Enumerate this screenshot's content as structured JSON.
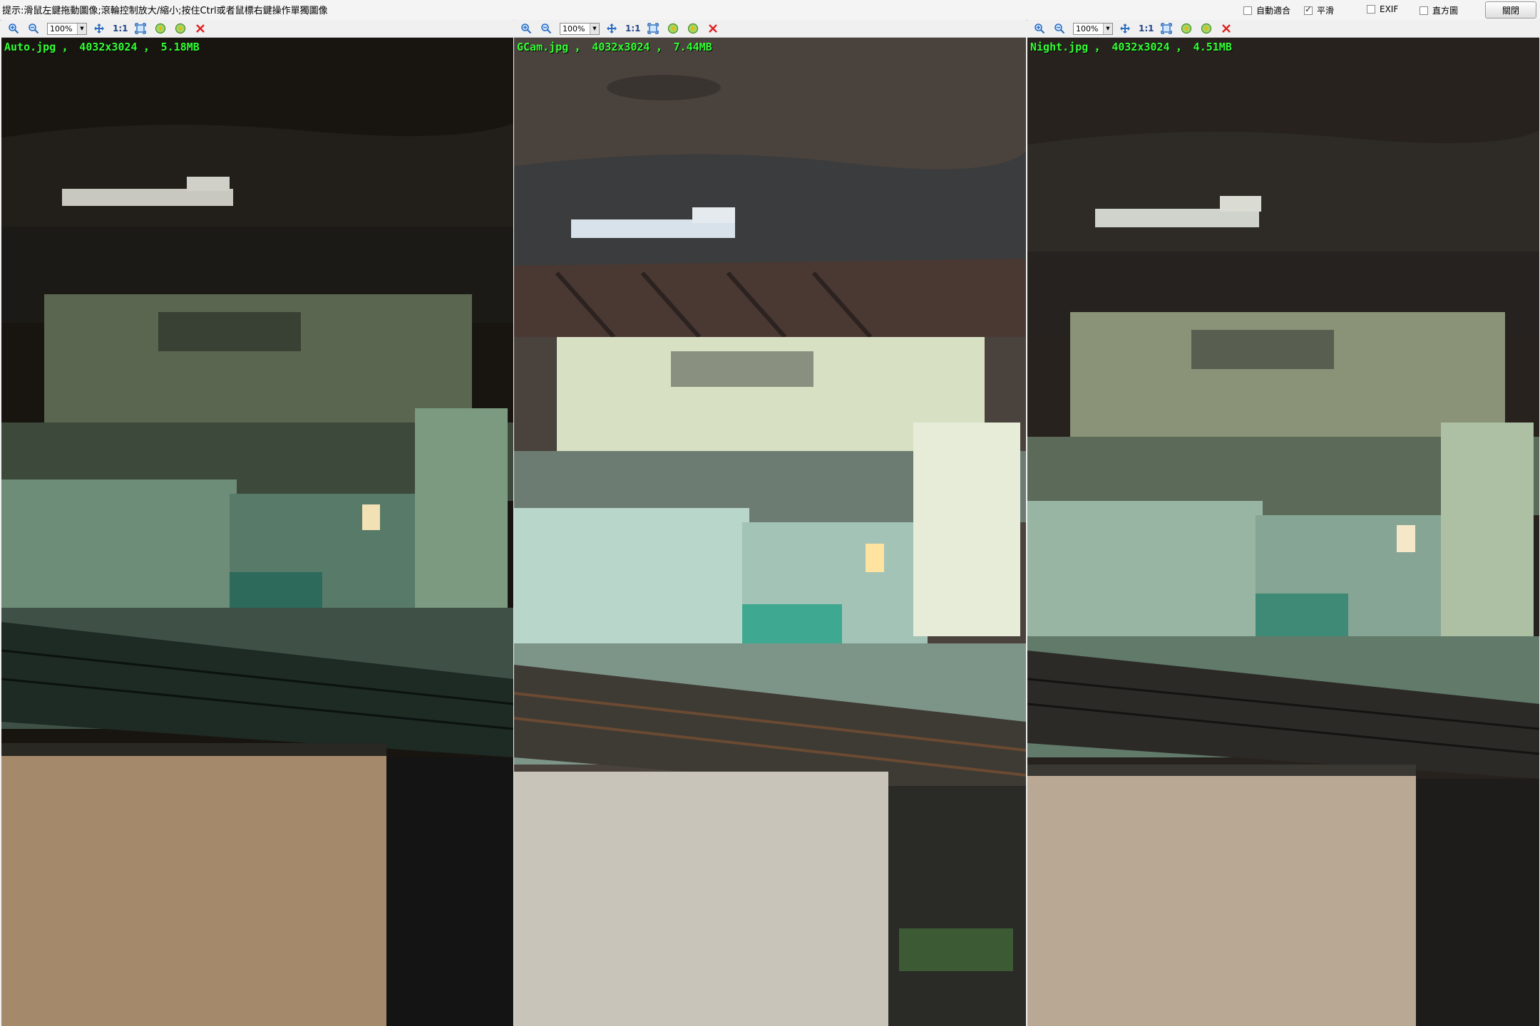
{
  "hint": "提示:滑鼠左鍵拖動圖像;滾輪控制放大/縮小;按住Ctrl或者鼠標右鍵操作單獨圖像",
  "options": [
    {
      "label": "自動適合",
      "checked": false
    },
    {
      "label": "平滑",
      "checked": true
    },
    {
      "label": "EXIF",
      "checked": false
    },
    {
      "label": "直方圖",
      "checked": false
    }
  ],
  "close_label": "關閉",
  "panels": [
    {
      "zoom": "100%",
      "one_to_one": "1:1",
      "caption": "Auto.jpg ， 4032x3024 ， 5.18MB"
    },
    {
      "zoom": "100%",
      "one_to_one": "1:1",
      "caption": "GCam.jpg ， 4032x3024 ， 7.44MB"
    },
    {
      "zoom": "100%",
      "one_to_one": "1:1",
      "caption": "Night.jpg ， 4032x3024 ， 4.51MB"
    }
  ],
  "icons": [
    "zoom-in-icon",
    "zoom-out-icon",
    "pan-icon",
    "fit-icon",
    "prev-image-icon",
    "next-image-icon",
    "close-x-icon"
  ],
  "colors": {
    "caption": "#33ff33",
    "close_x": "#e02020",
    "toolbar_icon": "#2a6cc0"
  }
}
